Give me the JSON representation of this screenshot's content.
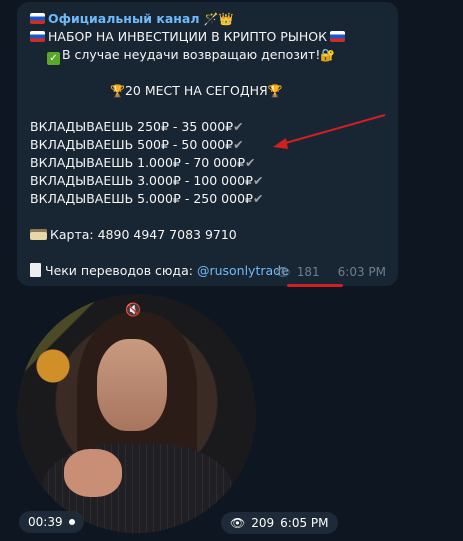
{
  "message": {
    "channel_name": "Официальный канал",
    "channel_emoji": "🪄👑",
    "heading": "НАБОР НА ИНВЕСТИЦИИ В КРИПТО РЫНОК",
    "refund": "В случае неудачи возвращаю депозит!",
    "refund_emoji": "🔐",
    "places": "20 МЕСТ НА СЕГОДНЯ",
    "places_emoji": "🏆",
    "offers": [
      "ВКЛАДЫВАЕШЬ 250₽ - 35 000₽",
      "ВКЛАДЫВАЕШЬ 500₽ - 50 000₽",
      "ВКЛАДЫВАЕШЬ 1.000₽ - 70 000₽",
      "ВКЛАДЫВАЕШЬ 3.000₽ - 100 000₽",
      "ВКЛАДЫВАЕШЬ 5.000₽ - 250 000₽"
    ],
    "check_glyph": "✔",
    "card_text": "Карта:   4890 4947 7083 9710",
    "receipts_text": "Чеки переводов сюда: ",
    "receipts_link": "@rusonlytrade",
    "views": "181",
    "time": "6:03 PM"
  },
  "video": {
    "duration": "00:39",
    "views": "209",
    "time": "6:05 PM",
    "mute_icon": "🔇"
  },
  "colors": {
    "background": "#0e1621",
    "bubble": "#182533",
    "link": "#71baf9",
    "annotation": "#d31f1f"
  }
}
